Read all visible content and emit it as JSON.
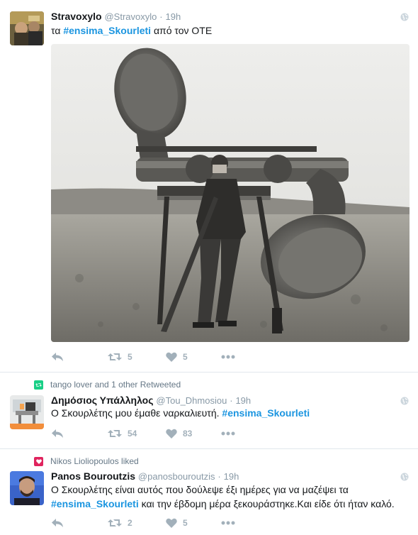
{
  "tweets": [
    {
      "name": "Stravoxylo",
      "handle": "@Stravoxylo",
      "time": "19h",
      "text_before": "τα ",
      "hashtag": "#ensima_Skourleti",
      "text_after": " από τον ΟΤΕ",
      "retweets": "5",
      "likes": "5"
    },
    {
      "context": "tango lover and 1 other Retweeted",
      "name": "Δημόσιος Υπάλληλος",
      "handle": "@Tou_Dhmosiou",
      "time": "19h",
      "text_before": "Ο Σκουρλέτης μου έμαθε ναρκαλιευτή. ",
      "hashtag": "#ensima_Skourleti",
      "text_after": "",
      "retweets": "54",
      "likes": "83"
    },
    {
      "context": "Nikos Lioliopoulos liked",
      "name": "Panos Bouroutzis",
      "handle": "@panosbouroutzis",
      "time": "19h",
      "line1": "Ο Σκουρλέτης είναι αυτός που δούλεψε έξι ημέρες για να μαζέψει τα",
      "hashtag": "#ensima_Skourleti",
      "line2_after": " και την έβδομη μέρα ξεκουράστηκε.Και είδε ότι ήταν καλό.",
      "retweets": "2",
      "likes": "5"
    }
  ],
  "colors": {
    "hashtag": "#1b95e0",
    "action_icon": "#a2b0ba",
    "retweet_badge": "#19cf86",
    "like_badge": "#e0245e"
  },
  "icons": [
    "globe-icon",
    "reply-icon",
    "retweet-icon",
    "heart-icon",
    "more-icon"
  ]
}
